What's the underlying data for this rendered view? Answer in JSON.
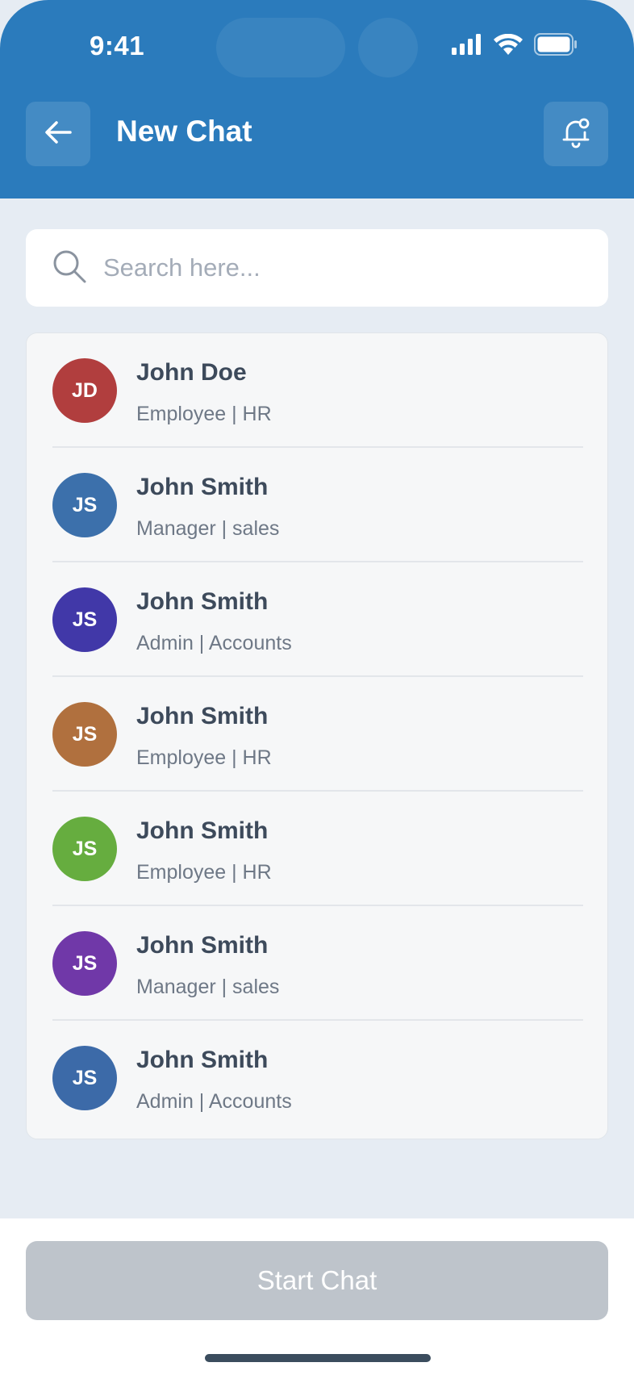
{
  "status_bar": {
    "time": "9:41"
  },
  "header": {
    "title": "New Chat"
  },
  "search": {
    "placeholder": "Search here..."
  },
  "contacts": [
    {
      "initials": "JD",
      "name": "John Doe",
      "role": "Employee | HR",
      "color": "#b13e3e"
    },
    {
      "initials": "JS",
      "name": "John Smith",
      "role": "Manager | sales",
      "color": "#3c70ab"
    },
    {
      "initials": "JS",
      "name": "John Smith",
      "role": "Admin | Accounts",
      "color": "#4138a8"
    },
    {
      "initials": "JS",
      "name": "John Smith",
      "role": "Employee | HR",
      "color": "#b0703e"
    },
    {
      "initials": "JS",
      "name": "John Smith",
      "role": "Employee | HR",
      "color": "#66ad3f"
    },
    {
      "initials": "JS",
      "name": "John Smith",
      "role": "Manager | sales",
      "color": "#7038a8"
    },
    {
      "initials": "JS",
      "name": "John Smith",
      "role": "Admin | Accounts",
      "color": "#3c6aa8"
    }
  ],
  "footer": {
    "start_label": "Start Chat"
  },
  "theme": {
    "header_bg": "#2b7bbc",
    "page_bg": "#e6ecf3",
    "button_disabled": "#bec4cb"
  },
  "icons": [
    "back-arrow-icon",
    "bell-icon",
    "search-icon",
    "signal-icon",
    "wifi-icon",
    "battery-icon"
  ]
}
